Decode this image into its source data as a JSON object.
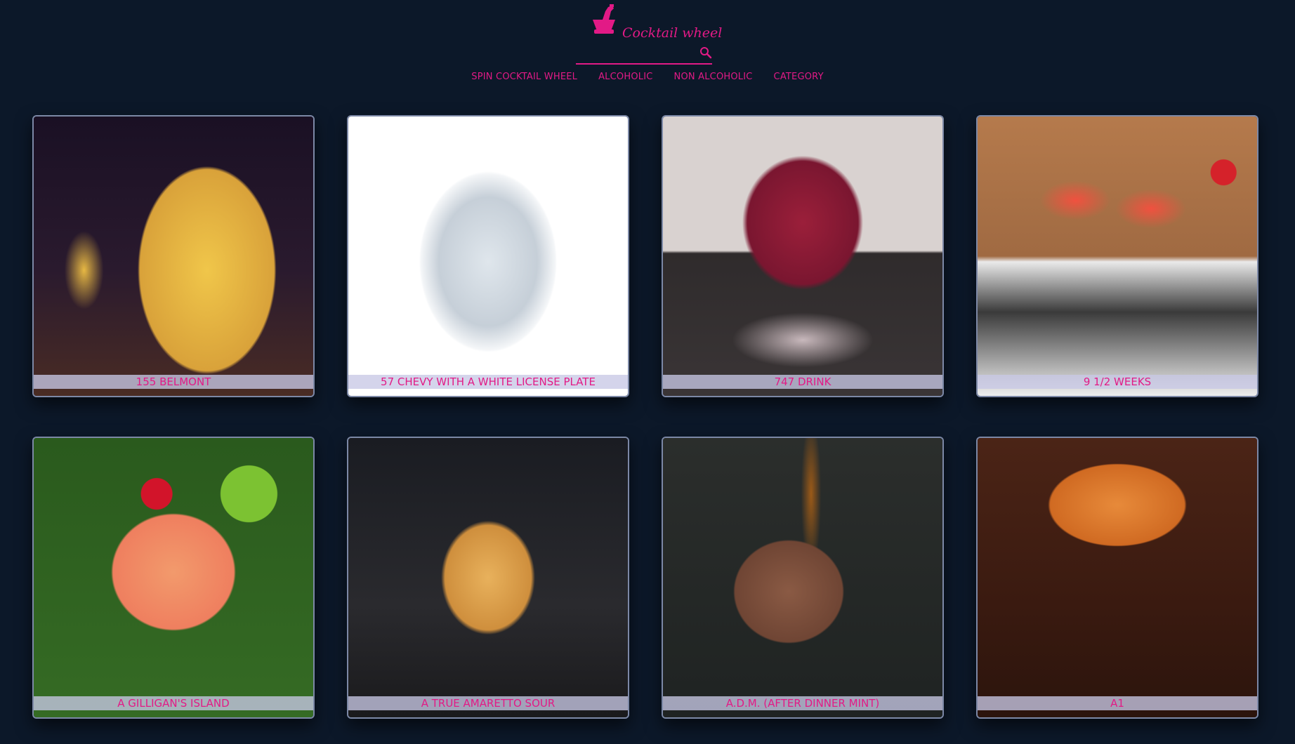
{
  "app": {
    "logo_text": "Cocktail wheel"
  },
  "search": {
    "placeholder": "",
    "value": ""
  },
  "nav": {
    "items": [
      {
        "label": "Spin Cocktail Wheel"
      },
      {
        "label": "Alcoholic"
      },
      {
        "label": "Non Alcoholic"
      },
      {
        "label": "Category"
      }
    ]
  },
  "drinks": [
    {
      "name": "155 Belmont"
    },
    {
      "name": "57 Chevy with a White License Plate"
    },
    {
      "name": "747 Drink"
    },
    {
      "name": "9 1/2 Weeks"
    },
    {
      "name": "A Gilligan's Island"
    },
    {
      "name": "A True Amaretto Sour"
    },
    {
      "name": "A.D.M. (After Dinner Mint)"
    },
    {
      "name": "A1"
    }
  ],
  "colors": {
    "background": "#0c1829",
    "accent": "#e21a86",
    "card_border": "#7c88a6",
    "caption_bg": "#c8c8e6"
  },
  "icons": {
    "logo": "cocktail-glass-icon",
    "search": "search-icon"
  }
}
